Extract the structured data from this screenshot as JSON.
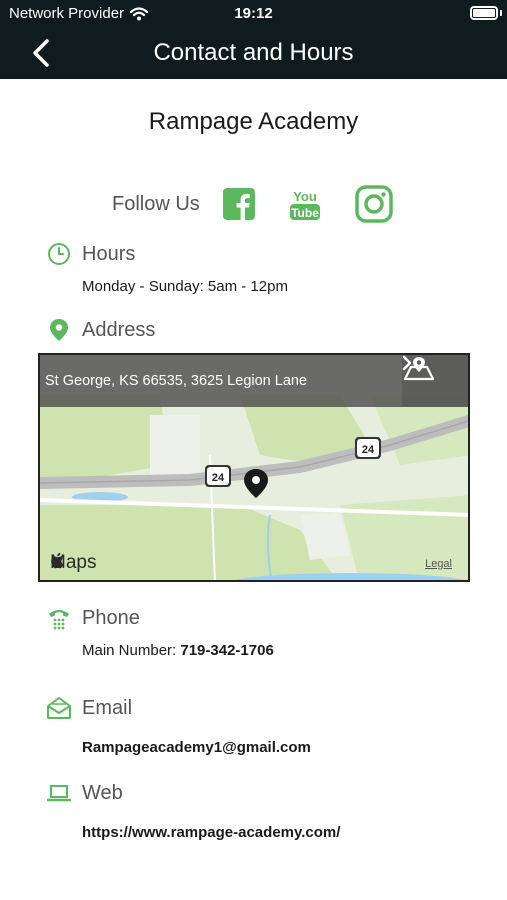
{
  "status_bar": {
    "carrier": "Network Provider",
    "time": "19:12"
  },
  "nav": {
    "title": "Contact and Hours"
  },
  "place_name": "Rampage Academy",
  "follow": {
    "label": "Follow Us",
    "facebook_icon": "facebook-icon",
    "youtube_line1": "You",
    "youtube_line2": "Tube",
    "instagram_icon": "instagram-icon"
  },
  "hours": {
    "label": "Hours",
    "text": "Monday - Sunday: 5am - 12pm"
  },
  "address": {
    "label": "Address",
    "text": "St George, KS 66535, 3625 Legion Lane",
    "map_logo": "Maps",
    "legal": "Legal",
    "route_shield": "24"
  },
  "phone": {
    "label": "Phone",
    "prefix": "Main Number: ",
    "number": "719-342-1706"
  },
  "email": {
    "label": "Email",
    "address": "Rampageacademy1@gmail.com"
  },
  "web": {
    "label": "Web",
    "url": "https://www.rampage-academy.com/"
  },
  "colors": {
    "accent": "#5cb85c",
    "header_bg": "#0f1b1e",
    "text": "#1a1a1a",
    "label": "#555555"
  }
}
